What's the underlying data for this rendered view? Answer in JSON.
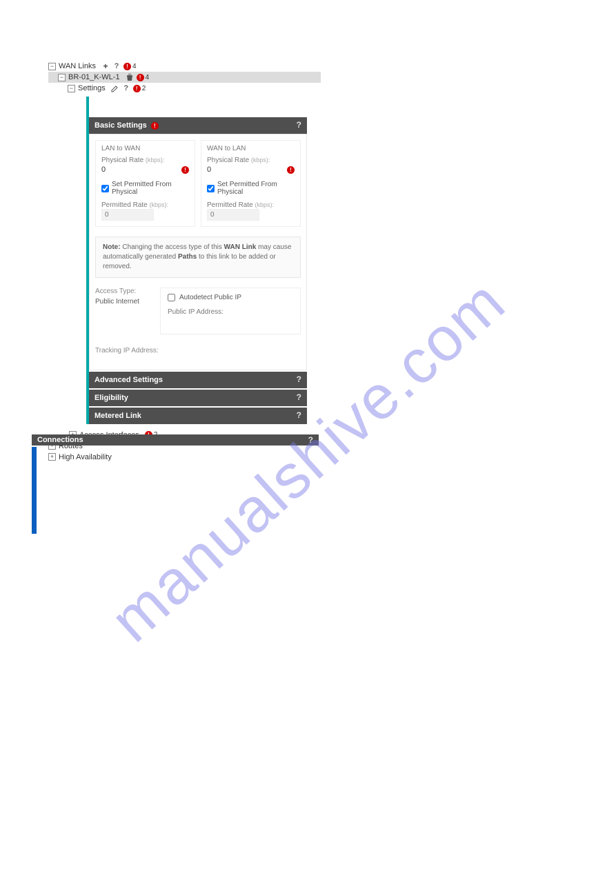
{
  "tree": {
    "root": {
      "label": "WAN Links",
      "err_count": "4"
    },
    "node1": {
      "label": "BR-01_K-WL-1",
      "err_count": "4"
    },
    "node2": {
      "label": "Settings",
      "err_count": "2"
    },
    "access_if": {
      "label": "Access Interfaces",
      "err_count": "2"
    },
    "routes": {
      "label": "Routes"
    },
    "ha": {
      "label": "High Availability"
    }
  },
  "sections": {
    "basic": "Basic Settings",
    "advanced": "Advanced Settings",
    "eligibility": "Eligibility",
    "metered": "Metered Link",
    "connections": "Connections"
  },
  "rate": {
    "l2w_hdr": "LAN to WAN",
    "w2l_hdr": "WAN to LAN",
    "phys_label": "Physical Rate",
    "phys_unit": "(kbps):",
    "l2w_val": "0",
    "w2l_val": "0",
    "set_perm": "Set Permitted From Physical",
    "perm_label": "Permitted Rate",
    "perm_unit": "(kbps):",
    "l2w_perm": "0",
    "w2l_perm": "0"
  },
  "note": {
    "lead": "Note:",
    "t1": " Changing the access type of this ",
    "b1": "WAN Link",
    "t2": " may cause automatically generated ",
    "b2": "Paths",
    "t3": " to this link to be added or removed."
  },
  "access": {
    "type_lbl": "Access Type:",
    "type_val": "Public Internet",
    "auto_lbl": "Autodetect Public IP",
    "pubip_lbl": "Public IP Address:",
    "track_lbl": "Tracking IP Address:"
  },
  "watermark": "manualshive.com"
}
